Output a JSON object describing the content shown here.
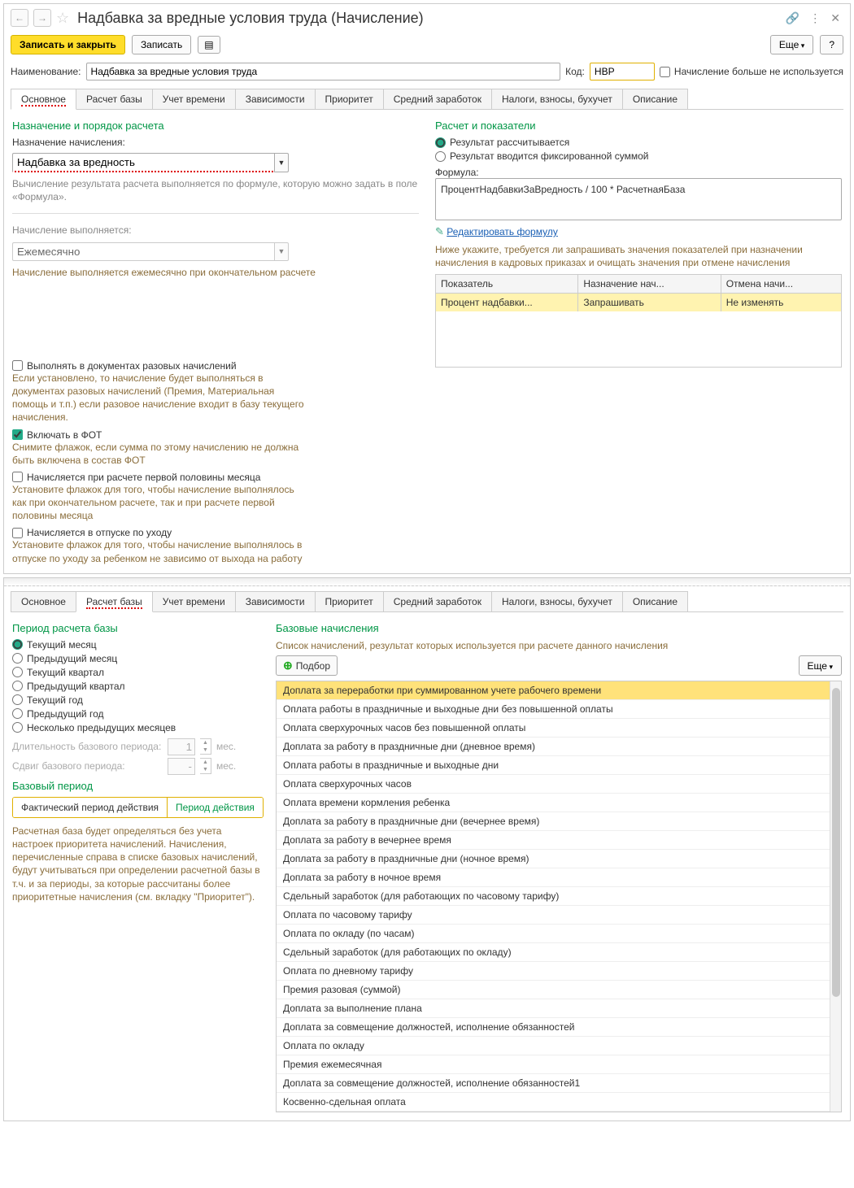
{
  "header": {
    "title": "Надбавка за вредные условия труда (Начисление)"
  },
  "toolbar": {
    "save_close": "Записать и закрыть",
    "save": "Записать",
    "more": "Еще",
    "help": "?"
  },
  "fields": {
    "name_lbl": "Наименование:",
    "name_val": "Надбавка за вредные условия труда",
    "code_lbl": "Код:",
    "code_val": "НВР",
    "not_used": "Начисление больше не используется"
  },
  "tabs": [
    "Основное",
    "Расчет базы",
    "Учет времени",
    "Зависимости",
    "Приоритет",
    "Средний заработок",
    "Налоги, взносы, бухучет",
    "Описание"
  ],
  "main": {
    "sect1_title": "Назначение и порядок расчета",
    "assign_lbl": "Назначение начисления:",
    "assign_val": "Надбавка за вредность",
    "assign_hint": "Вычисление результата расчета выполняется по формуле, которую можно задать в поле «Формула».",
    "exec_lbl": "Начисление выполняется:",
    "exec_val": "Ежемесячно",
    "exec_hint": "Начисление выполняется ежемесячно при окончательном расчете",
    "chk_once": "Выполнять в документах разовых начислений",
    "chk_once_hint": "Если установлено, то начисление будет выполняться в документах разовых начислений (Премия, Материальная помощь и т.п.) если разовое начисление входит в базу текущего начисления.",
    "chk_fot": "Включать в ФОТ",
    "chk_fot_hint": "Снимите флажок, если сумма по этому начислению не должна быть включена в состав ФОТ",
    "chk_half": "Начисляется при расчете первой половины месяца",
    "chk_half_hint": "Установите флажок для того, чтобы начисление выполнялось как при окончательном расчете, так и при расчете первой половины месяца",
    "chk_leave": "Начисляется в отпуске по уходу",
    "chk_leave_hint": "Установите флажок для того, чтобы начисление выполнялось в отпуске по уходу за ребенком не зависимо от выхода на работу"
  },
  "calc": {
    "title": "Расчет и показатели",
    "r1": "Результат рассчитывается",
    "r2": "Результат вводится фиксированной суммой",
    "formula_lbl": "Формула:",
    "formula": "ПроцентНадбавкиЗаВредность / 100 * РасчетнаяБаза",
    "edit_link": "Редактировать формулу",
    "hint": "Ниже укажите, требуется ли запрашивать значения показателей при назначении начисления в кадровых приказах и очищать значения при отмене начисления",
    "th1": "Показатель",
    "th2": "Назначение нач...",
    "th3": "Отмена начи...",
    "td1": "Процент надбавки...",
    "td2": "Запрашивать",
    "td3": "Не изменять"
  },
  "base": {
    "tabs": [
      "Основное",
      "Расчет базы",
      "Учет времени",
      "Зависимости",
      "Приоритет",
      "Средний заработок",
      "Налоги, взносы, бухучет",
      "Описание"
    ],
    "period_title": "Период расчета базы",
    "radios": [
      "Текущий месяц",
      "Предыдущий месяц",
      "Текущий квартал",
      "Предыдущий квартал",
      "Текущий год",
      "Предыдущий год",
      "Несколько предыдущих месяцев"
    ],
    "len_lbl": "Длительность базового периода:",
    "len_val": "1",
    "len_unit": "мес.",
    "shift_lbl": "Сдвиг базового периода:",
    "shift_val": "-",
    "shift_unit": "мес.",
    "bp_title": "Базовый период",
    "bp_opt1": "Фактический период действия",
    "bp_opt2": "Период действия",
    "bp_hint": "Расчетная база будет определяться без учета настроек приоритета начислений. Начисления, перечисленные справа в списке базовых начислений, будут учитываться при определении расчетной базы в т.ч. и за периоды, за которые рассчитаны более приоритетные начисления (см. вкладку \"Приоритет\").",
    "list_title": "Базовые начисления",
    "list_hint": "Список начислений, результат которых используется при расчете данного начисления",
    "pick": "Подбор",
    "more": "Еще",
    "items": [
      "Доплата за переработки при суммированном учете рабочего времени",
      "Оплата работы в праздничные и выходные дни без повышенной оплаты",
      "Оплата сверхурочных часов без повышенной оплаты",
      "Доплата за работу в праздничные дни (дневное время)",
      "Оплата работы в праздничные и выходные дни",
      "Оплата сверхурочных часов",
      "Оплата времени кормления ребенка",
      "Доплата за работу в праздничные дни (вечернее время)",
      "Доплата за работу в вечернее время",
      "Доплата за работу в праздничные дни (ночное время)",
      "Доплата за работу в ночное время",
      "Сдельный заработок (для работающих по часовому тарифу)",
      "Оплата по часовому тарифу",
      "Оплата по окладу (по часам)",
      "Сдельный заработок (для работающих по окладу)",
      "Оплата по дневному тарифу",
      "Премия разовая (суммой)",
      "Доплата за выполнение плана",
      "Доплата за совмещение должностей, исполнение обязанностей",
      "Оплата по окладу",
      "Премия ежемесячная",
      "Доплата за совмещение должностей, исполнение обязанностей1",
      "Косвенно-сдельная оплата"
    ]
  }
}
